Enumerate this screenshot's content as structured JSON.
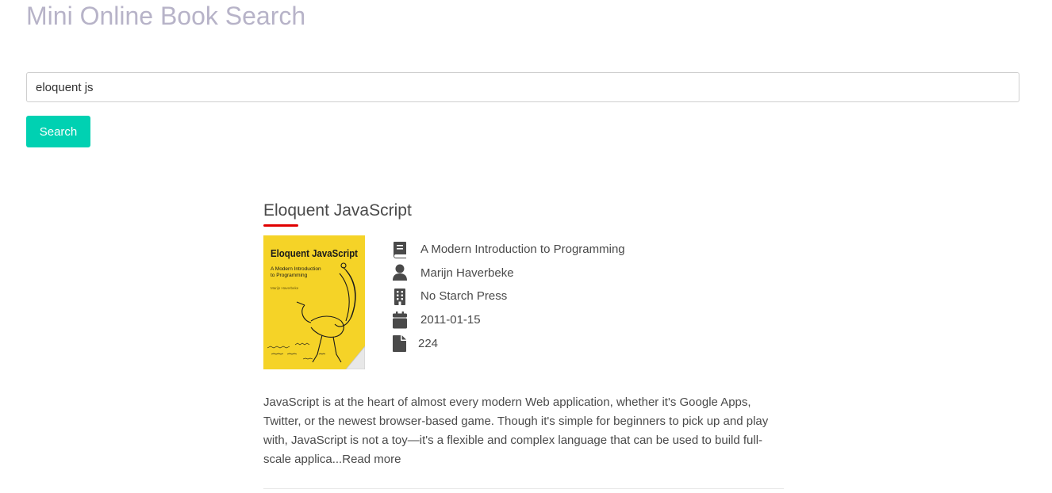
{
  "app": {
    "title": "Mini Online Book Search"
  },
  "search": {
    "value": "eloquent js",
    "button_label": "Search"
  },
  "colors": {
    "accent": "#00d1b2",
    "underline": "#e00000",
    "icon": "#4a4a4a",
    "cover_bg": "#f5d327"
  },
  "result": {
    "title": "Eloquent JavaScript",
    "cover": {
      "title": "Eloquent JavaScript",
      "subtitle_line1": "A Modern Introduction",
      "subtitle_line2": "to Programming",
      "author": "Marijn Haverbeke"
    },
    "meta": [
      {
        "icon": "book-icon",
        "value": "A Modern Introduction to Programming"
      },
      {
        "icon": "user-icon",
        "value": "Marijn Haverbeke"
      },
      {
        "icon": "building-icon",
        "value": "No Starch Press"
      },
      {
        "icon": "calendar-icon",
        "value": "2011-01-15"
      },
      {
        "icon": "file-icon",
        "value": "224"
      }
    ],
    "description": "JavaScript is at the heart of almost every modern Web application, whether it's Google Apps, Twitter, or the newest browser-based game. Though it's simple for beginners to pick up and play with, JavaScript is not a toy—it's a flexible and complex language that can be used to build full-scale applica...",
    "read_more_label": "Read more"
  }
}
